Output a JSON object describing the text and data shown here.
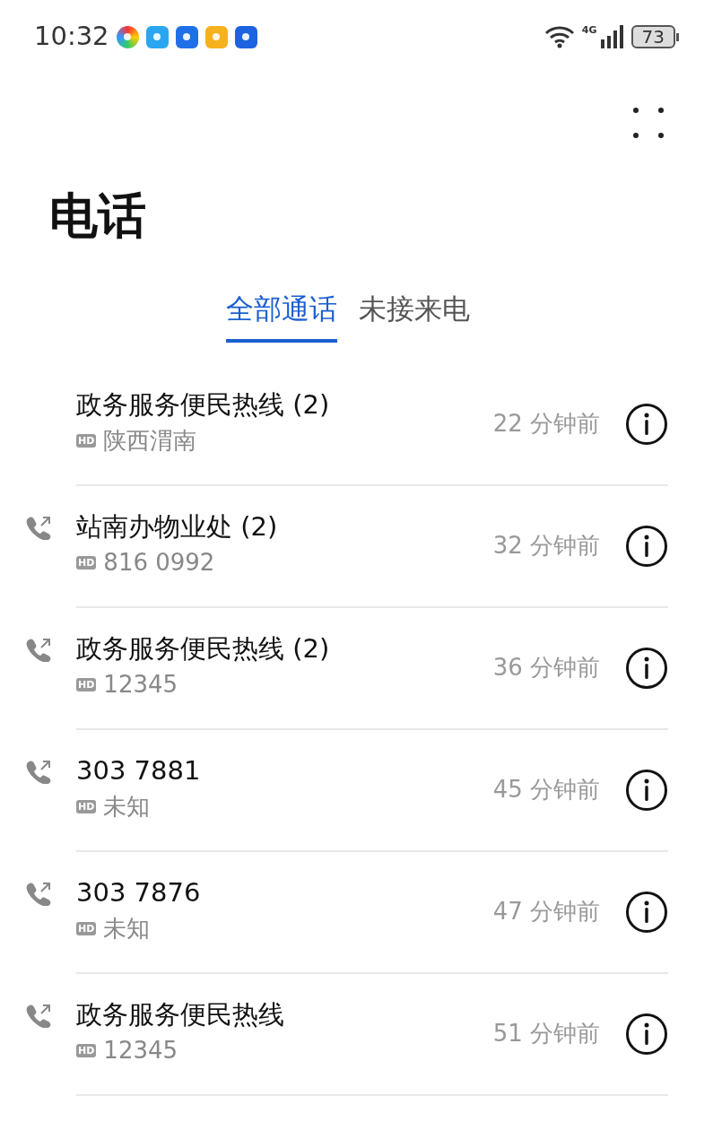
{
  "status_bar": {
    "time": "10:32",
    "network": "4G",
    "battery": "73"
  },
  "title": "电话",
  "tabs": [
    {
      "label": "全部通话",
      "selected": true
    },
    {
      "label": "未接来电",
      "selected": false
    }
  ],
  "calls": [
    {
      "name": "政务服务便民热线 (2)",
      "outgoing": false,
      "hd": "HD",
      "detail": "陕西渭南",
      "time": "22 分钟前"
    },
    {
      "name": "站南办物业处 (2)",
      "outgoing": true,
      "hd": "HD",
      "detail": "816 0992",
      "time": "32 分钟前"
    },
    {
      "name": "政务服务便民热线 (2)",
      "outgoing": true,
      "hd": "HD",
      "detail": "12345",
      "time": "36 分钟前"
    },
    {
      "name": "303 7881",
      "outgoing": true,
      "hd": "HD",
      "detail": "未知",
      "time": "45 分钟前"
    },
    {
      "name": "303 7876",
      "outgoing": true,
      "hd": "HD",
      "detail": "未知",
      "time": "47 分钟前"
    },
    {
      "name": "政务服务便民热线",
      "outgoing": true,
      "hd": "HD",
      "detail": "12345",
      "time": "51 分钟前"
    }
  ]
}
